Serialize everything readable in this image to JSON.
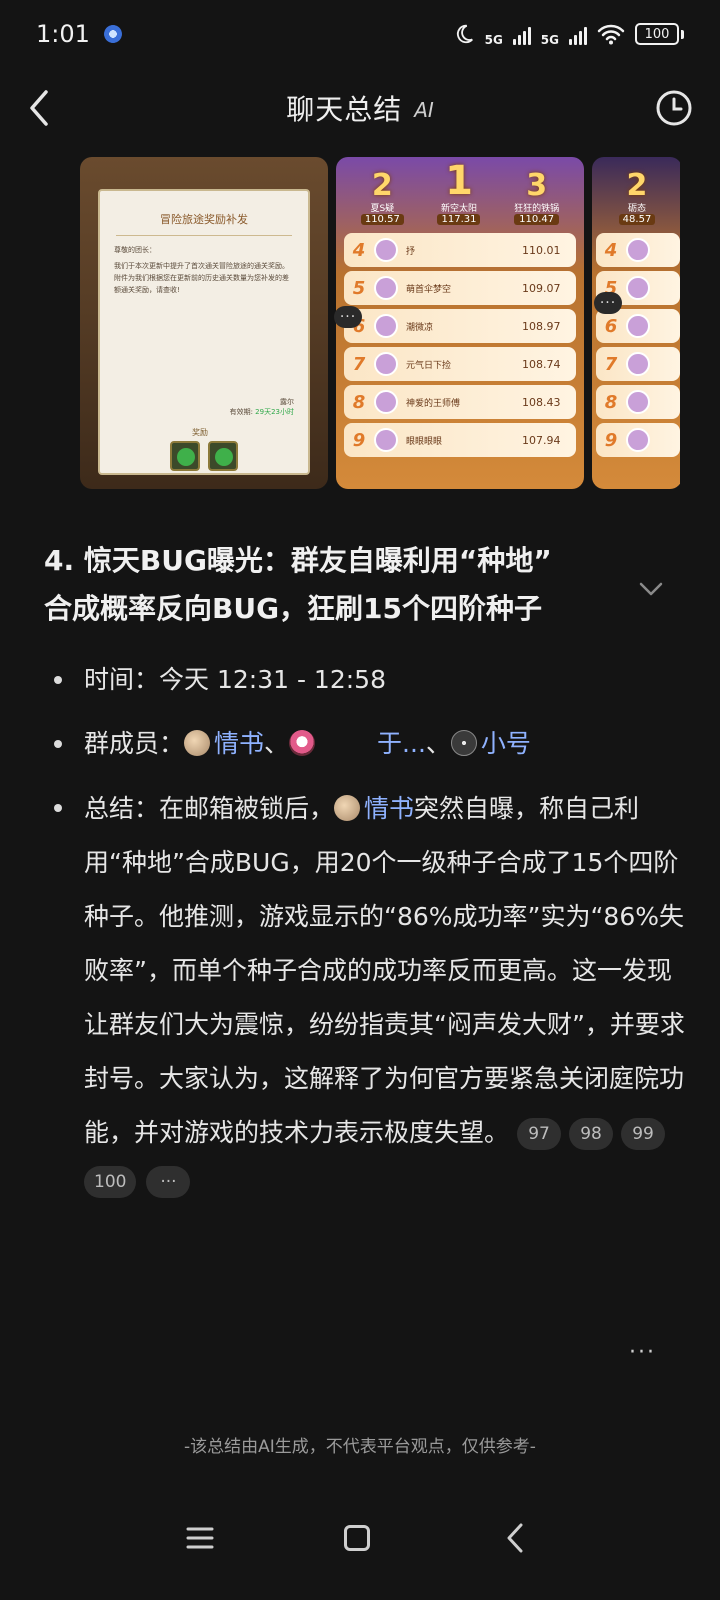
{
  "status_bar": {
    "time": "1:01",
    "net1": "5G",
    "net2": "5G",
    "battery": "100"
  },
  "header": {
    "title": "聊天总结",
    "ai_label": "AI"
  },
  "images": {
    "doc_title": "冒险旅途奖励补发",
    "doc_greeting": "尊敬的团长：",
    "doc_body": "我们于本次更新中提升了首次通关冒险旅途的通关奖励。附件为我们根据您在更新前的历史通关数量为您补发的差额通关奖励，请查收!",
    "doc_sender": "露尔",
    "doc_expiry_label": "有效期:",
    "doc_expiry_value": "29天23小时",
    "doc_reward_label": "奖励",
    "podium": [
      {
        "rank": "2",
        "name": "夏S疑",
        "score": "110.57"
      },
      {
        "rank": "1",
        "name": "新空太阳",
        "score": "117.31"
      },
      {
        "rank": "3",
        "name": "狂狂的铁锅",
        "score": "110.47"
      }
    ],
    "rows": [
      {
        "rank": "4",
        "name": "抒",
        "score": "110.01"
      },
      {
        "rank": "5",
        "name": "萌首伞梦空",
        "score": "109.07"
      },
      {
        "rank": "6",
        "name": "潮微凉",
        "score": "108.97"
      },
      {
        "rank": "7",
        "name": "元气日下捡",
        "score": "108.74"
      },
      {
        "rank": "8",
        "name": "神爱的王师傅",
        "score": "108.43"
      },
      {
        "rank": "9",
        "name": "眼眼眼眼",
        "score": "107.94"
      }
    ],
    "third_podium": {
      "rank": "2",
      "name": "砺态",
      "score": "48.57"
    },
    "third_rows": [
      "4",
      "5",
      "6",
      "7",
      "8",
      "9"
    ]
  },
  "section": {
    "heading_line1": "4. 惊天BUG曝光：群友自曝利用“种地”",
    "heading_line2": "合成概率反向BUG，狂刷15个四阶种子",
    "time_label": "时间：",
    "time_value": "今天 12:31 - 12:58",
    "members_label": "群成员：",
    "member1": "情书",
    "sep1": "、",
    "member2": "于...",
    "sep2": "、",
    "member3": "小号",
    "summary_label": "总结：",
    "summary_pre": "在邮箱被锁后，",
    "summary_mention": "情书",
    "summary_body": "突然自曝，称自己利用“种地”合成BUG，用20个一级种子合成了15个四阶种子。他推测，游戏显示的“86%成功率”实为“86%失败率”，而单个种子合成的成功率反而更高。这一发现让群友们大为震惊，纷纷指责其“闷声发大财”，并要求封号。大家认为，这解释了为何官方要紧急关闭庭院功能，并对游戏的技术力表示极度失望。",
    "citations_inline": [
      "97",
      "98",
      "99"
    ],
    "citations_row": [
      "100",
      "···"
    ]
  },
  "more_menu": "···",
  "disclaimer": "-该总结由AI生成，不代表平台观点，仅供参考-",
  "colors": {
    "background": "#141414",
    "mention": "#8fb2ff",
    "chip": "#2f2f2f"
  }
}
